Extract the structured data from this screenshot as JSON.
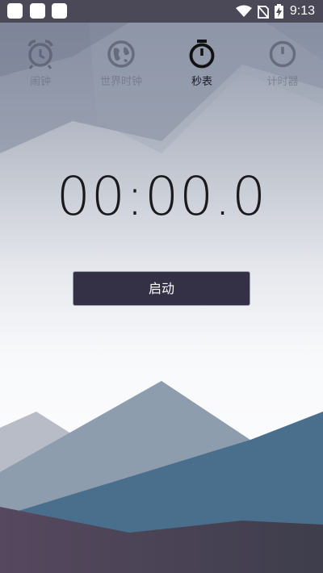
{
  "status_bar": {
    "time": "9:13",
    "icons": [
      "app-square-icon",
      "app-square-icon",
      "app-square-icon",
      "wifi-icon",
      "no-sim-icon",
      "battery-charging-icon"
    ]
  },
  "tabs": [
    {
      "label": "闹钟",
      "icon": "alarm-clock-icon",
      "active": false
    },
    {
      "label": "世界时钟",
      "icon": "world-clock-icon",
      "active": false
    },
    {
      "label": "秒表",
      "icon": "stopwatch-icon",
      "active": true
    },
    {
      "label": "计时器",
      "icon": "timer-icon",
      "active": false
    }
  ],
  "stopwatch": {
    "display": "00:00.0",
    "start_label": "启动"
  },
  "colors": {
    "status_bar": "#4b4957",
    "button": "#343046",
    "mountain_blue": "#4a6f8c",
    "mountain_purple": "#4f4560"
  }
}
